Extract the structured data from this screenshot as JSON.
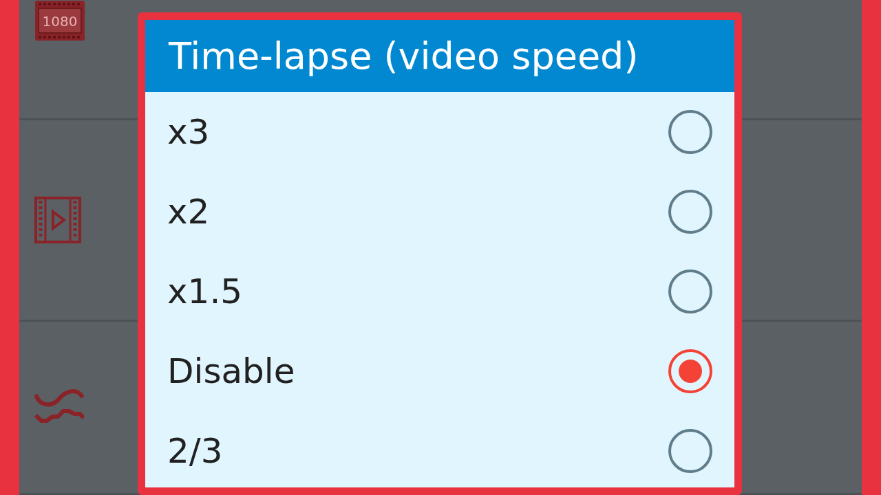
{
  "settings_list": {
    "resolution_badge": "1080"
  },
  "dialog": {
    "title": "Time-lapse (video speed)",
    "options": [
      {
        "label": "x3",
        "selected": false
      },
      {
        "label": "x2",
        "selected": false
      },
      {
        "label": "x1.5",
        "selected": false
      },
      {
        "label": "Disable",
        "selected": true
      },
      {
        "label": "2/3",
        "selected": false
      }
    ]
  }
}
